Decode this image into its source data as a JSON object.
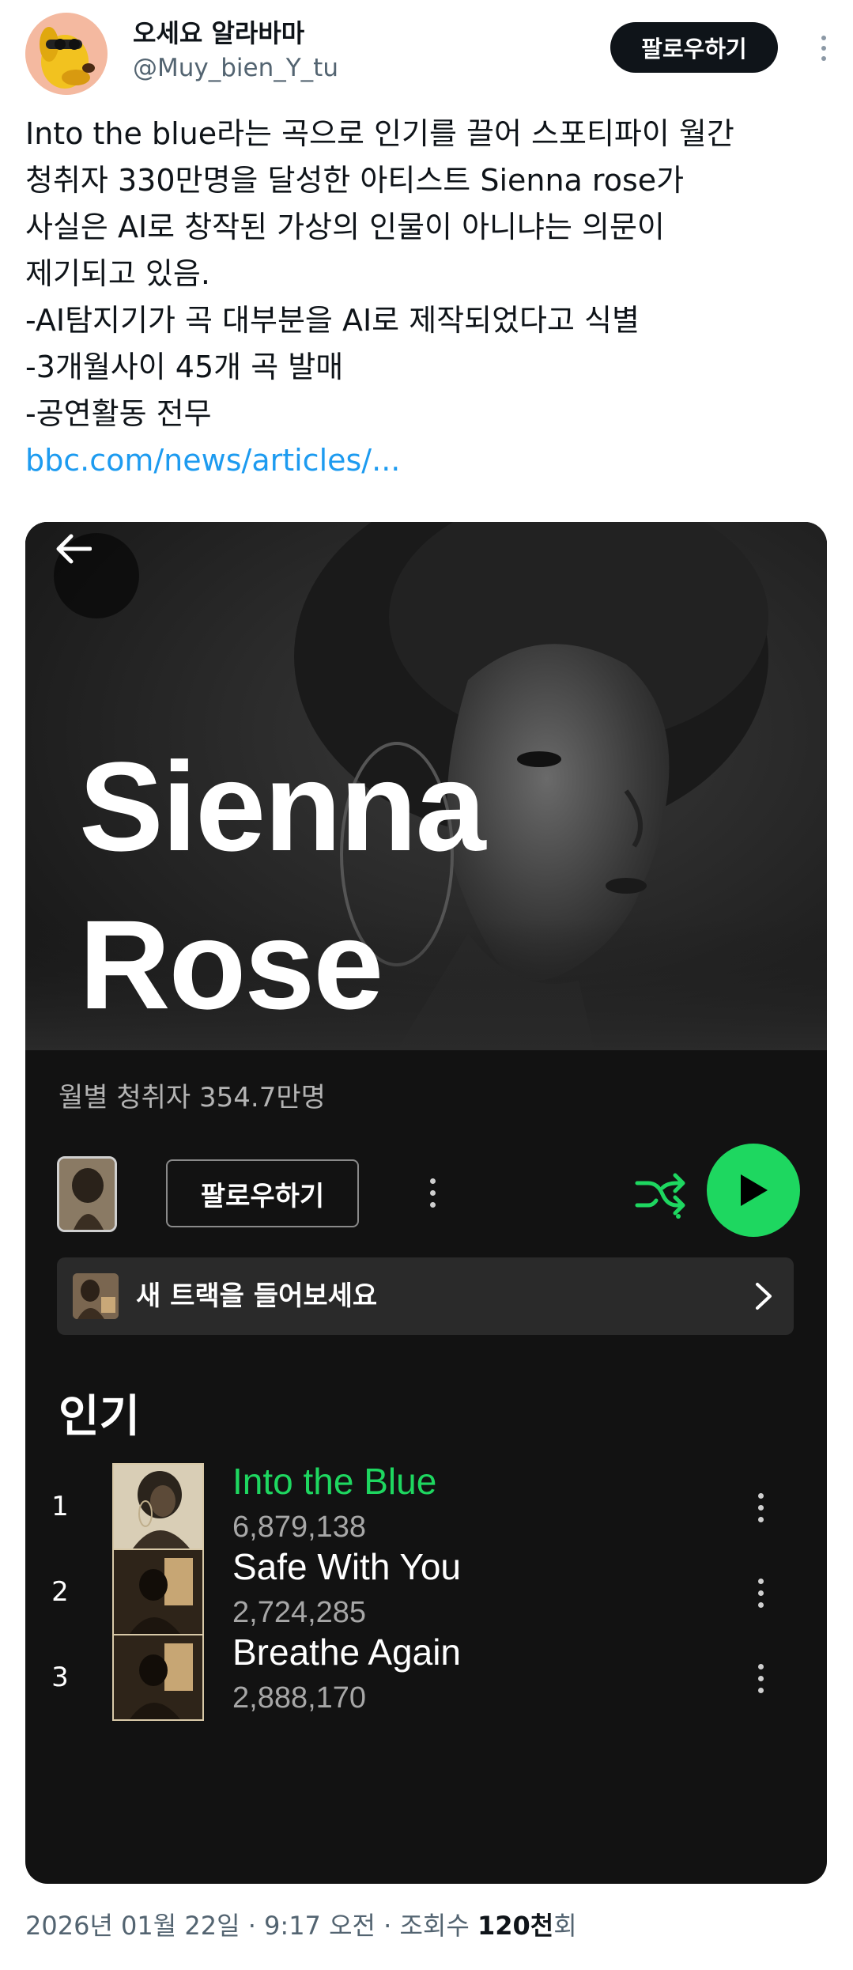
{
  "tweet": {
    "display_name": "오세요 알라바마",
    "handle": "@Muy_bien_Y_tu",
    "follow_label": "팔로우하기",
    "text_lines": [
      "Into the blue라는 곡으로 인기를 끌어 스포티파이 월간",
      "청취자 330만명을 달성한 아티스트 Sienna rose가",
      "사실은 AI로 창작된 가상의 인물이 아니냐는 의문이",
      "제기되고 있음.",
      "-AI탐지기가 곡 대부분을 AI로 제작되었다고 식별",
      "-3개월사이 45개 곡 발매",
      "-공연활동 전무"
    ],
    "link": "bbc.com/news/articles/...",
    "timestamp": "2026년 01월 22일 · 9:17 오전 · 조회수 ",
    "views": "120천",
    "views_suffix": "회"
  },
  "spotify": {
    "artist_line1": "Sienna",
    "artist_line2": "Rose",
    "monthly_listeners": "월별 청취자 354.7만명",
    "follow_label": "팔로우하기",
    "new_tracks_label": "새 트랙을 들어보세요",
    "popular_title": "인기",
    "accent_color": "#1ed760",
    "tracks": [
      {
        "rank": "1",
        "title": "Into the Blue",
        "plays": "6,879,138",
        "playing": true
      },
      {
        "rank": "2",
        "title": "Safe With You",
        "plays": "2,724,285",
        "playing": false
      },
      {
        "rank": "3",
        "title": "Breathe Again",
        "plays": "2,888,170",
        "playing": false
      }
    ],
    "icons": [
      "back-arrow-icon",
      "more-vertical-icon",
      "shuffle-icon",
      "play-icon",
      "chevron-right-icon"
    ]
  }
}
